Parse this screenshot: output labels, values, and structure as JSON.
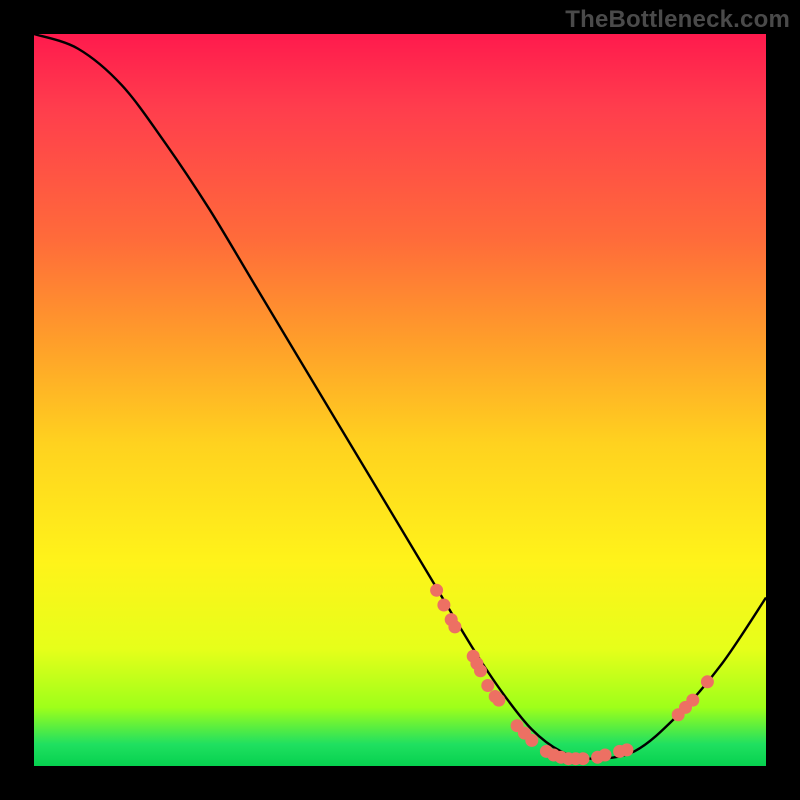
{
  "watermark": "TheBottleneck.com",
  "chart_data": {
    "type": "line",
    "title": "",
    "xlabel": "",
    "ylabel": "",
    "xlim": [
      0,
      100
    ],
    "ylim": [
      0,
      100
    ],
    "grid": false,
    "series": [
      {
        "name": "curve",
        "x": [
          0,
          6,
          12,
          18,
          24,
          30,
          36,
          42,
          48,
          54,
          60,
          64,
          68,
          72,
          76,
          82,
          88,
          94,
          100
        ],
        "y": [
          100,
          98,
          93,
          85,
          76,
          66,
          56,
          46,
          36,
          26,
          16,
          10,
          5,
          2,
          1,
          2,
          7,
          14,
          23
        ]
      }
    ],
    "markers": [
      {
        "x": 55,
        "y": 24
      },
      {
        "x": 56,
        "y": 22
      },
      {
        "x": 57,
        "y": 20
      },
      {
        "x": 57.5,
        "y": 19
      },
      {
        "x": 60,
        "y": 15
      },
      {
        "x": 60.5,
        "y": 14
      },
      {
        "x": 61,
        "y": 13
      },
      {
        "x": 62,
        "y": 11
      },
      {
        "x": 63,
        "y": 9.5
      },
      {
        "x": 63.5,
        "y": 9
      },
      {
        "x": 66,
        "y": 5.5
      },
      {
        "x": 67,
        "y": 4.5
      },
      {
        "x": 68,
        "y": 3.5
      },
      {
        "x": 70,
        "y": 2
      },
      {
        "x": 71,
        "y": 1.5
      },
      {
        "x": 72,
        "y": 1.2
      },
      {
        "x": 73,
        "y": 1
      },
      {
        "x": 74,
        "y": 1
      },
      {
        "x": 75,
        "y": 1
      },
      {
        "x": 77,
        "y": 1.2
      },
      {
        "x": 78,
        "y": 1.5
      },
      {
        "x": 80,
        "y": 2
      },
      {
        "x": 81,
        "y": 2.2
      },
      {
        "x": 88,
        "y": 7
      },
      {
        "x": 89,
        "y": 8
      },
      {
        "x": 90,
        "y": 9
      },
      {
        "x": 92,
        "y": 11.5
      }
    ],
    "marker_color": "#ed7063",
    "curve_color": "#000000"
  }
}
